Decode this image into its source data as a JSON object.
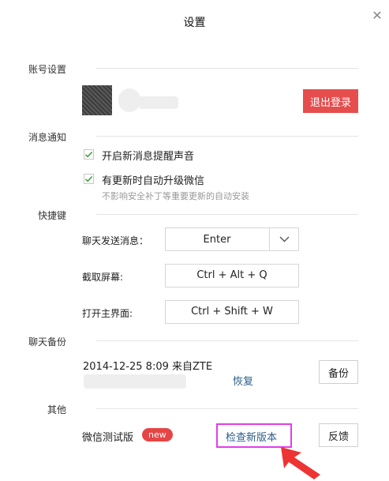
{
  "window": {
    "title": "设置"
  },
  "sections": {
    "account": "账号设置",
    "notify": "消息通知",
    "shortcut": "快捷键",
    "backup": "聊天备份",
    "other": "其他"
  },
  "account": {
    "logout_label": "退出登录"
  },
  "notify": {
    "opt1_label": "开启新消息提醒声音",
    "opt2_label": "有更新时自动升级微信",
    "opt2_hint": "不影响安全补丁等重要更新的自动安装"
  },
  "shortcuts": {
    "send": {
      "label": "聊天发送消息：",
      "value": "Enter"
    },
    "screenshot": {
      "label": "截取屏幕:",
      "value": "Ctrl + Alt + Q"
    },
    "open_main": {
      "label": "打开主界面:",
      "value": "Ctrl + Shift + W"
    }
  },
  "backup": {
    "entry": "2014-12-25 8:09 来自ZTE",
    "restore_label": "恢复",
    "backup_label": "备份"
  },
  "other": {
    "beta_label": "微信测试版",
    "new_badge": "new",
    "check_update_label": "检查新版本",
    "feedback_label": "反馈"
  },
  "colors": {
    "accent_red": "#e64d4d",
    "link_blue": "#2a5d8a",
    "highlight_magenta": "#e23ee8"
  },
  "icons": {
    "close": "close-icon",
    "check": "check-icon",
    "dropdown": "chevron-down-icon"
  }
}
